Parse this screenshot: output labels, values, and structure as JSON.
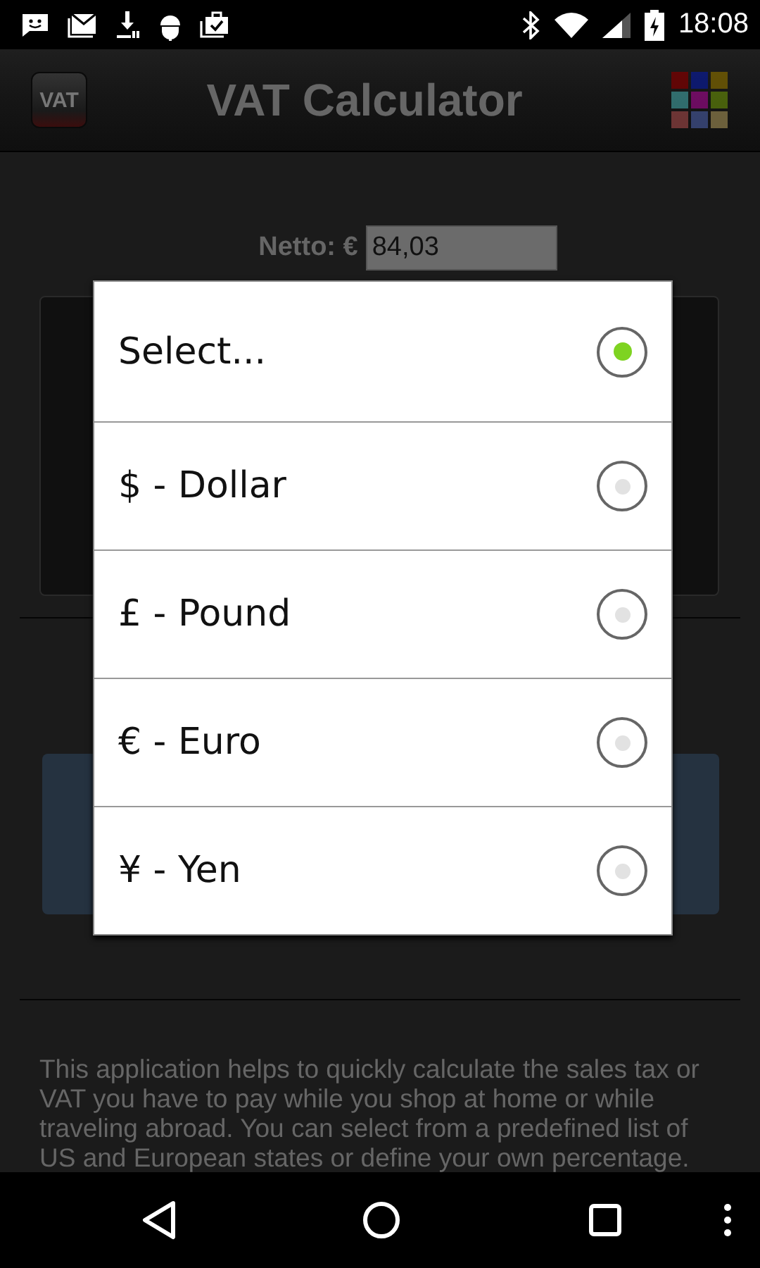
{
  "status_bar": {
    "time": "18:08"
  },
  "app_bar": {
    "logo_text": "VAT",
    "title": "VAT Calculator"
  },
  "netto": {
    "label": "Netto: €",
    "value": "84,03"
  },
  "dialog": {
    "options": [
      {
        "label": "Select...",
        "selected": true
      },
      {
        "label": "$ - Dollar",
        "selected": false
      },
      {
        "label": "£ - Pound",
        "selected": false
      },
      {
        "label": "€ - Euro",
        "selected": false
      },
      {
        "label": "¥ - Yen",
        "selected": false
      }
    ]
  },
  "description": "This application helps to quickly calculate the sales tax or VAT you have to pay while you shop at home or while traveling abroad. You can select from a predefined list of US and European states or define your own percentage."
}
